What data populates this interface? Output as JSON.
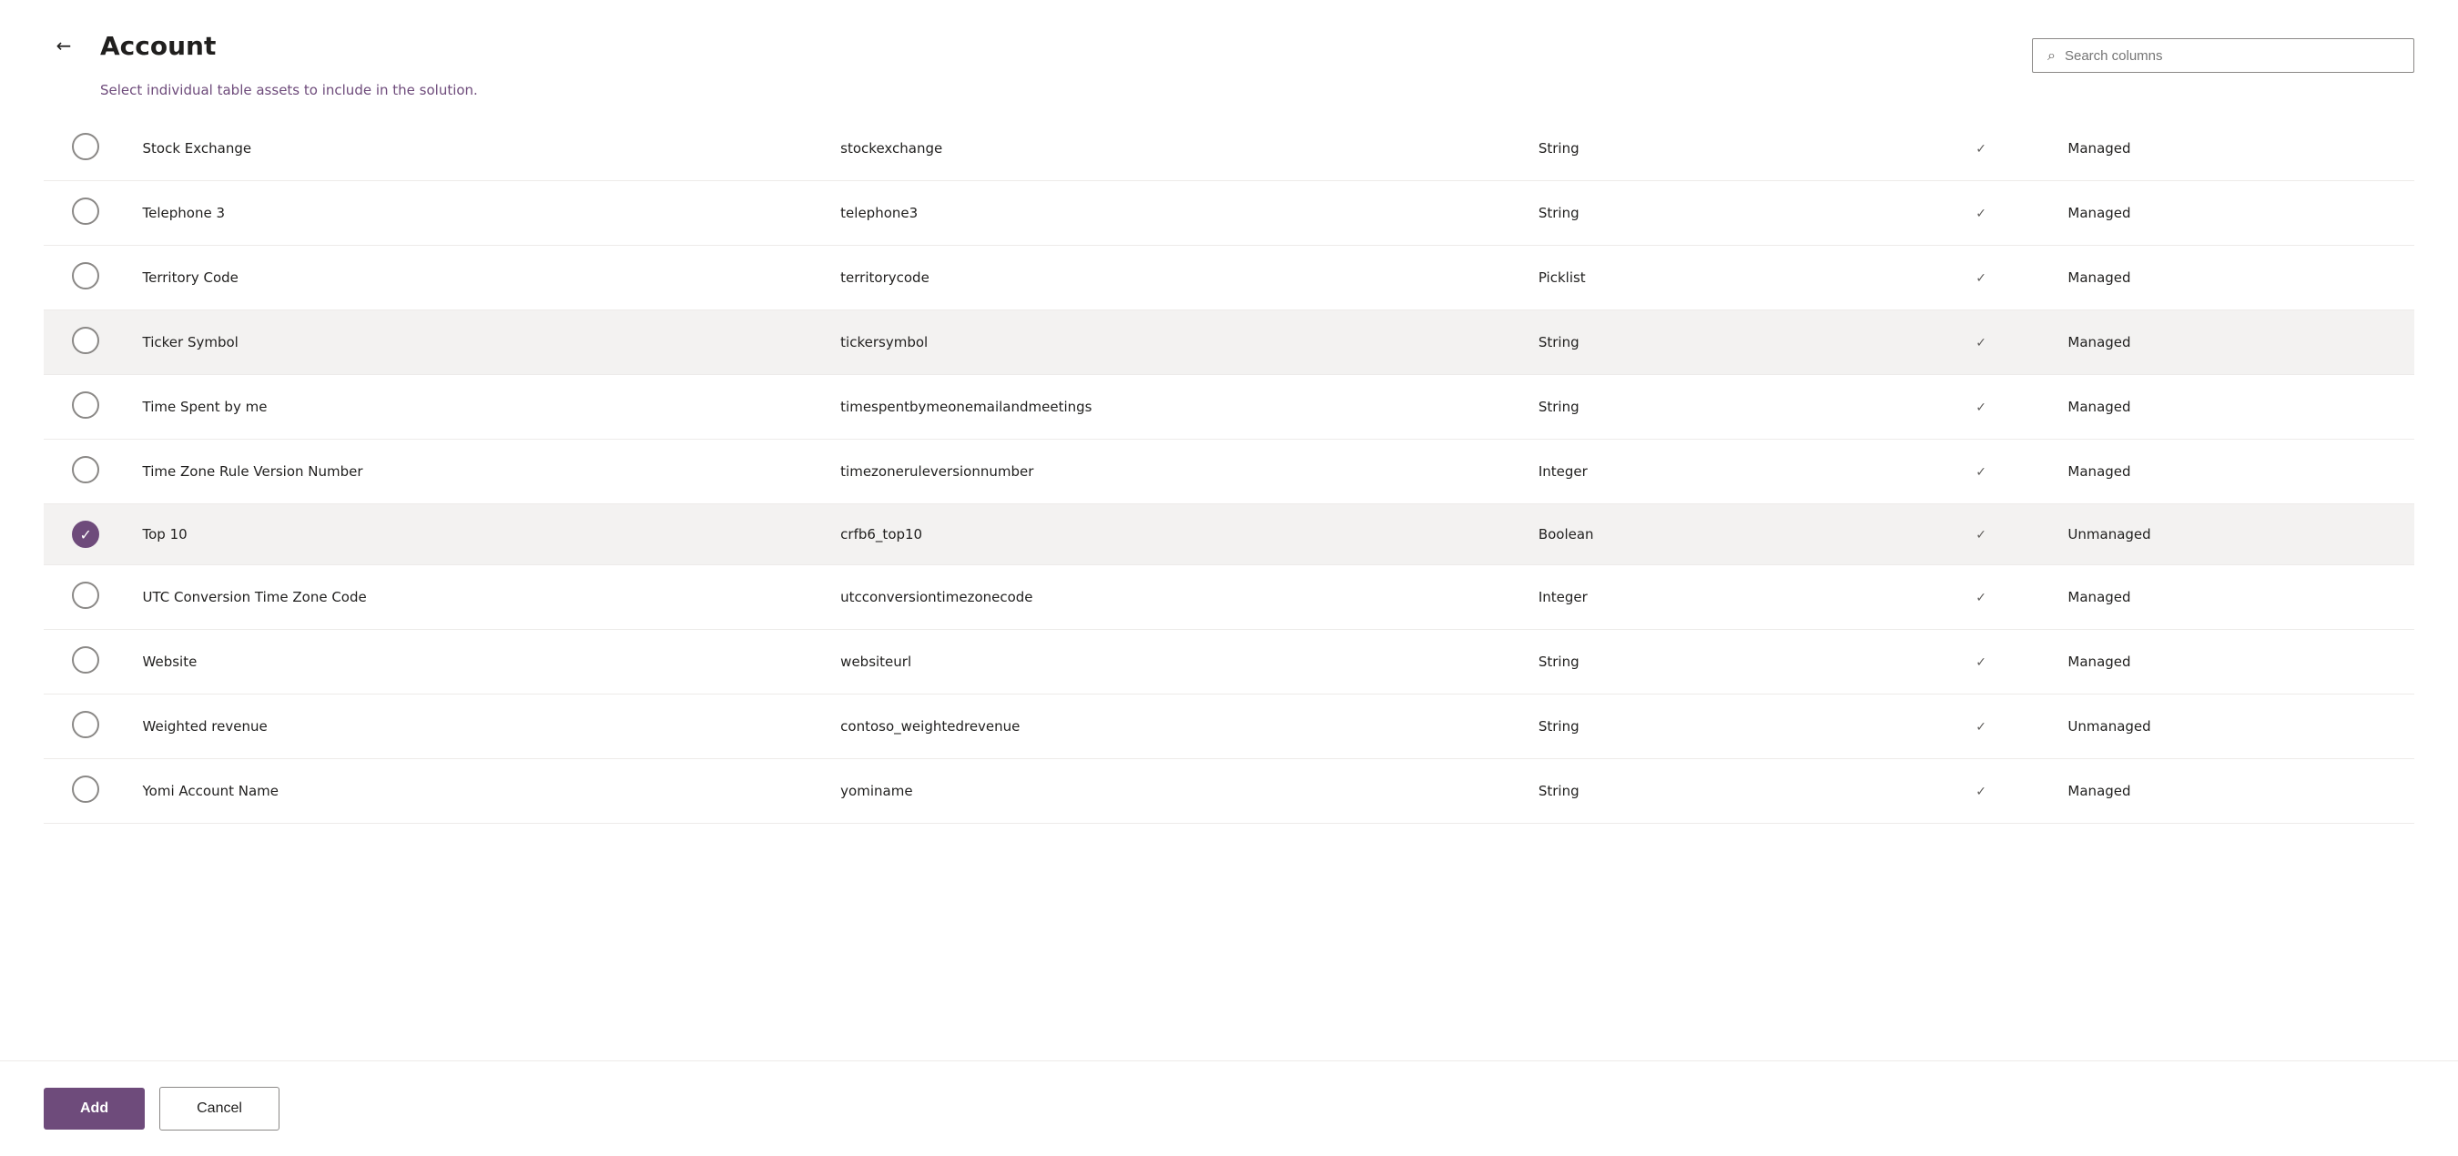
{
  "header": {
    "back_label": "←",
    "title": "Account",
    "close_label": "✕"
  },
  "subtitle": {
    "prefix": "Select ",
    "highlight": "individual table assets",
    "suffix": " to include in the solution."
  },
  "search": {
    "placeholder": "Search columns",
    "icon": "🔍"
  },
  "table": {
    "rows": [
      {
        "checked": false,
        "name": "Stock Exchange",
        "logical": "stockexchange",
        "type": "String",
        "has_check": true,
        "managed": "Managed"
      },
      {
        "checked": false,
        "name": "Telephone 3",
        "logical": "telephone3",
        "type": "String",
        "has_check": true,
        "managed": "Managed"
      },
      {
        "checked": false,
        "name": "Territory Code",
        "logical": "territorycode",
        "type": "Picklist",
        "has_check": true,
        "managed": "Managed"
      },
      {
        "checked": false,
        "name": "Ticker Symbol",
        "logical": "tickersymbol",
        "type": "String",
        "has_check": true,
        "managed": "Managed",
        "highlighted": true
      },
      {
        "checked": false,
        "name": "Time Spent by me",
        "logical": "timespentbymeonemailandmeetings",
        "type": "String",
        "has_check": true,
        "managed": "Managed"
      },
      {
        "checked": false,
        "name": "Time Zone Rule Version Number",
        "logical": "timezoneruleversionnumber",
        "type": "Integer",
        "has_check": true,
        "managed": "Managed"
      },
      {
        "checked": true,
        "name": "Top 10",
        "logical": "crfb6_top10",
        "type": "Boolean",
        "has_check": true,
        "managed": "Unmanaged",
        "highlighted": true
      },
      {
        "checked": false,
        "name": "UTC Conversion Time Zone Code",
        "logical": "utcconversiontimezonecode",
        "type": "Integer",
        "has_check": true,
        "managed": "Managed"
      },
      {
        "checked": false,
        "name": "Website",
        "logical": "websiteurl",
        "type": "String",
        "has_check": true,
        "managed": "Managed"
      },
      {
        "checked": false,
        "name": "Weighted revenue",
        "logical": "contoso_weightedrevenue",
        "type": "String",
        "has_check": true,
        "managed": "Unmanaged"
      },
      {
        "checked": false,
        "name": "Yomi Account Name",
        "logical": "yominame",
        "type": "String",
        "has_check": true,
        "managed": "Managed"
      }
    ]
  },
  "footer": {
    "add_label": "Add",
    "cancel_label": "Cancel"
  }
}
